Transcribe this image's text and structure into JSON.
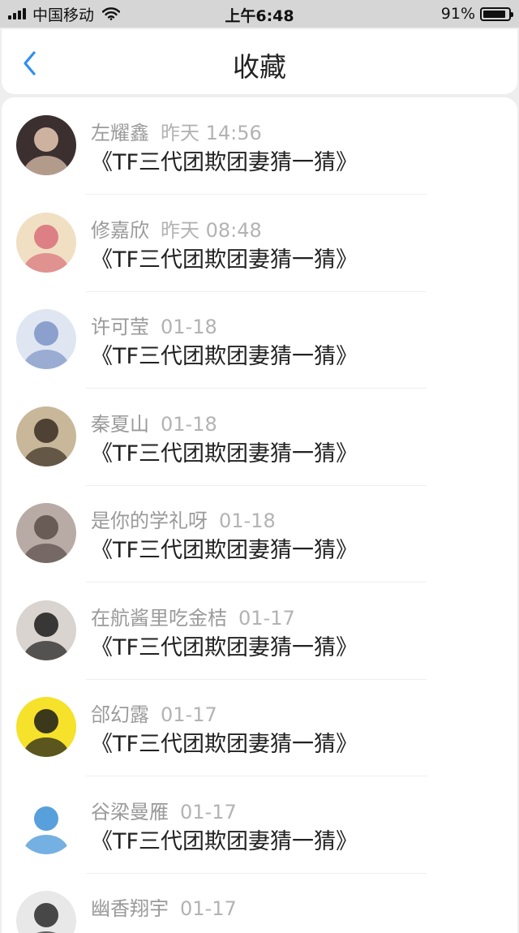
{
  "status_bar": {
    "carrier": "中国移动",
    "time": "上午6:48",
    "battery_percent": "91%",
    "battery_level": 0.91
  },
  "nav": {
    "title": "收藏",
    "back_icon": "chevron-left-icon"
  },
  "favorites": [
    {
      "name": "左耀鑫",
      "time": "昨天 14:56",
      "title": "《TF三代团欺团妻猜一猜》",
      "avatar_colors": [
        "#3b2f2f",
        "#e7c9b4"
      ]
    },
    {
      "name": "修嘉欣",
      "time": "昨天 08:48",
      "title": "《TF三代团欺团妻猜一猜》",
      "avatar_colors": [
        "#f1dfc4",
        "#d8707a"
      ]
    },
    {
      "name": "许可莹",
      "time": "01-18",
      "title": "《TF三代团欺团妻猜一猜》",
      "avatar_colors": [
        "#dfe6f2",
        "#7d93c6"
      ]
    },
    {
      "name": "秦夏山",
      "time": "01-18",
      "title": "《TF三代团欺团妻猜一猜》",
      "avatar_colors": [
        "#c9b79a",
        "#3a2e22"
      ]
    },
    {
      "name": "是你的学礼呀",
      "time": "01-18",
      "title": "《TF三代团欺团妻猜一猜》",
      "avatar_colors": [
        "#b8aba6",
        "#5a4c48"
      ]
    },
    {
      "name": "在航酱里吃金桔",
      "time": "01-17",
      "title": "《TF三代团欺团妻猜一猜》",
      "avatar_colors": [
        "#d9d4cf",
        "#1b1b1b"
      ]
    },
    {
      "name": "郃幻露",
      "time": "01-17",
      "title": "《TF三代团欺团妻猜一猜》",
      "avatar_colors": [
        "#f6e12b",
        "#1a1a1a"
      ]
    },
    {
      "name": "谷梁曼雁",
      "time": "01-17",
      "title": "《TF三代团欺团妻猜一猜》",
      "avatar_colors": [
        "#ffffff",
        "#3a8fd6"
      ]
    },
    {
      "name": "幽香翔宇",
      "time": "01-17",
      "title": "",
      "avatar_colors": [
        "#e8e8e8",
        "#2a2a2a"
      ]
    }
  ]
}
